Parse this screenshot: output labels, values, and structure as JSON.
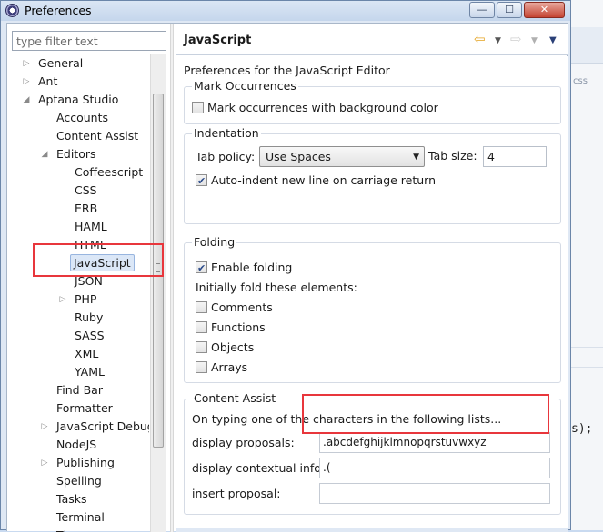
{
  "window": {
    "title": "Preferences",
    "minimize_glyph": "—",
    "maximize_glyph": "☐",
    "close_glyph": "✕"
  },
  "filter": {
    "placeholder": "type filter text",
    "value": ""
  },
  "tree": [
    {
      "label": "General",
      "depth": 0,
      "arrow": "collapsed"
    },
    {
      "label": "Ant",
      "depth": 0,
      "arrow": "collapsed"
    },
    {
      "label": "Aptana Studio",
      "depth": 0,
      "arrow": "expanded"
    },
    {
      "label": "Accounts",
      "depth": 1,
      "arrow": "none"
    },
    {
      "label": "Content Assist",
      "depth": 1,
      "arrow": "none"
    },
    {
      "label": "Editors",
      "depth": 1,
      "arrow": "expanded"
    },
    {
      "label": "Coffeescript",
      "depth": 2,
      "arrow": "none"
    },
    {
      "label": "CSS",
      "depth": 2,
      "arrow": "none"
    },
    {
      "label": "ERB",
      "depth": 2,
      "arrow": "none"
    },
    {
      "label": "HAML",
      "depth": 2,
      "arrow": "none"
    },
    {
      "label": "HTML",
      "depth": 2,
      "arrow": "none"
    },
    {
      "label": "JavaScript",
      "depth": 2,
      "arrow": "none",
      "selected": true
    },
    {
      "label": "JSON",
      "depth": 2,
      "arrow": "none"
    },
    {
      "label": "PHP",
      "depth": 2,
      "arrow": "collapsed"
    },
    {
      "label": "Ruby",
      "depth": 2,
      "arrow": "none"
    },
    {
      "label": "SASS",
      "depth": 2,
      "arrow": "none"
    },
    {
      "label": "XML",
      "depth": 2,
      "arrow": "none"
    },
    {
      "label": "YAML",
      "depth": 2,
      "arrow": "none"
    },
    {
      "label": "Find Bar",
      "depth": 1,
      "arrow": "none"
    },
    {
      "label": "Formatter",
      "depth": 1,
      "arrow": "none"
    },
    {
      "label": "JavaScript Debug",
      "depth": 1,
      "arrow": "collapsed"
    },
    {
      "label": "NodeJS",
      "depth": 1,
      "arrow": "none"
    },
    {
      "label": "Publishing",
      "depth": 1,
      "arrow": "collapsed"
    },
    {
      "label": "Spelling",
      "depth": 1,
      "arrow": "none"
    },
    {
      "label": "Tasks",
      "depth": 1,
      "arrow": "none"
    },
    {
      "label": "Terminal",
      "depth": 1,
      "arrow": "none"
    },
    {
      "label": "Th",
      "depth": 1,
      "arrow": "none"
    }
  ],
  "page": {
    "title": "JavaScript",
    "nav": {
      "back": "⇦",
      "forward": "⇨",
      "dropdown": "▼",
      "menu": "▼"
    },
    "description": "Preferences for the JavaScript Editor",
    "mark_occurrences": {
      "label": "Mark Occurrences",
      "checkbox_label": "Mark occurrences with background color",
      "checked": false
    },
    "indentation": {
      "label": "Indentation",
      "tab_policy_label": "Tab policy:",
      "tab_policy_value": "Use Spaces",
      "tab_size_label": "Tab size:",
      "tab_size_value": "4",
      "auto_indent_label": "Auto-indent new line on carriage return",
      "auto_indent_checked": true
    },
    "folding": {
      "label": "Folding",
      "enable_label": "Enable folding",
      "enable_checked": true,
      "initially_fold_label": "Initially fold these elements:",
      "items": [
        {
          "label": "Comments",
          "checked": false
        },
        {
          "label": "Functions",
          "checked": false
        },
        {
          "label": "Objects",
          "checked": false
        },
        {
          "label": "Arrays",
          "checked": false
        }
      ]
    },
    "content_assist": {
      "label": "Content Assist",
      "intro": "On typing one of the characters in the following lists...",
      "display_proposals_label": "display proposals:",
      "display_proposals_value": ".abcdefghijklmnopqrstuvwxyz",
      "display_contextual_label": "display contextual info:",
      "display_contextual_value": ".(",
      "insert_proposal_label": "insert proposal:",
      "insert_proposal_value": ""
    }
  },
  "background": {
    "css_hint": "css",
    "code_hint": "s);"
  },
  "colors": {
    "annotation_red": "#e8363c",
    "selection_blue": "#dbe7f7"
  }
}
